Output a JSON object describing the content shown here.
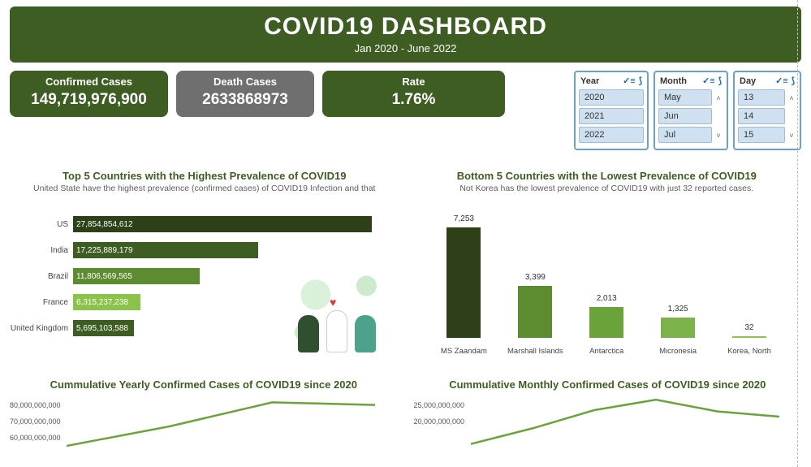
{
  "header": {
    "title": "COVID19 DASHBOARD",
    "subtitle": "Jan 2020 - June 2022"
  },
  "kpi": {
    "confirmed": {
      "label": "Confirmed Cases",
      "value": "149,719,976,900"
    },
    "deaths": {
      "label": "Death Cases",
      "value": "2633868973"
    },
    "rate": {
      "label": "Rate",
      "value": "1.76%"
    }
  },
  "slicers": {
    "year": {
      "label": "Year",
      "options": [
        "2020",
        "2021",
        "2022"
      ]
    },
    "month": {
      "label": "Month",
      "options": [
        "May",
        "Jun",
        "Jul"
      ]
    },
    "day": {
      "label": "Day",
      "options": [
        "13",
        "14",
        "15"
      ]
    }
  },
  "chart_data": [
    {
      "type": "bar",
      "orientation": "horizontal",
      "title": "Top 5 Countries with the Highest Prevalence of COVID19",
      "subtitle": "United State have the highest prevalence (confirmed cases) of COVID19 Infection and that",
      "categories": [
        "US",
        "India",
        "Brazil",
        "France",
        "United Kingdom"
      ],
      "values": [
        27854854612,
        17225889179,
        11806569565,
        6315237238,
        5695103588
      ],
      "value_labels": [
        "27,854,854,612",
        "17,225,889,179",
        "11,806,569,565",
        "6,315,237,238",
        "5,695,103,588"
      ],
      "colors": [
        "#2d4018",
        "#3e5d22",
        "#5d8b2f",
        "#8bc34a",
        "#3e5d22"
      ],
      "xlim": [
        0,
        28000000000
      ]
    },
    {
      "type": "bar",
      "orientation": "vertical",
      "title": "Bottom 5 Countries with the Lowest Prevalence of COVID19",
      "subtitle": "Not Korea has the lowest prevalence of COVID19 with just 32 reported cases.",
      "categories": [
        "MS Zaandam",
        "Marshall Islands",
        "Antarctica",
        "Micronesia",
        "Korea, North"
      ],
      "values": [
        7253,
        3399,
        2013,
        1325,
        32
      ],
      "value_labels": [
        "7,253",
        "3,399",
        "2,013",
        "1,325",
        "32"
      ],
      "colors": [
        "#2d4018",
        "#5d8b2f",
        "#6aa33a",
        "#7bb24a",
        "#8bc34a"
      ],
      "ylim": [
        0,
        8000
      ]
    },
    {
      "type": "line",
      "title": "Cummulative Yearly Confirmed Cases of COVID19 since 2020",
      "y_ticks": [
        80000000000,
        70000000000,
        60000000000
      ],
      "y_tick_labels": [
        "80,000,000,000",
        "70,000,000,000",
        "60,000,000,000"
      ],
      "ylim": [
        0,
        80000000000
      ],
      "ylabel": "",
      "xlabel": "",
      "visible_points_relative": [
        0.25,
        0.55,
        0.92,
        0.88
      ]
    },
    {
      "type": "line",
      "title": "Cummulative Monthly Confirmed Cases of COVID19 since 2020",
      "y_ticks": [
        25000000000,
        20000000000
      ],
      "y_tick_labels": [
        "25,000,000,000",
        "20,000,000,000"
      ],
      "ylim": [
        0,
        25000000000
      ],
      "ylabel": "",
      "xlabel": "",
      "visible_points_relative": [
        0.28,
        0.52,
        0.8,
        0.96,
        0.78,
        0.7
      ]
    }
  ]
}
